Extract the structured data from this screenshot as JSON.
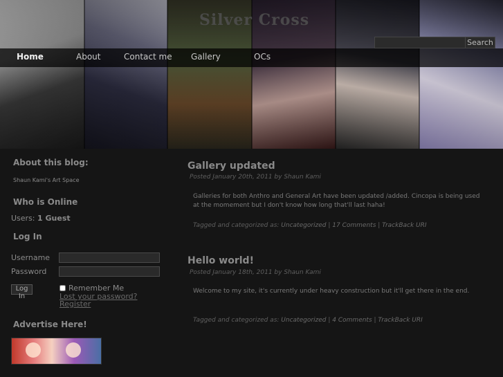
{
  "header": {
    "site_title": "Silver Cross",
    "search_placeholder": "",
    "search_button": "Search"
  },
  "nav": [
    {
      "label": "Home",
      "active": true
    },
    {
      "label": "About"
    },
    {
      "label": "Contact me"
    },
    {
      "label": "Gallery"
    },
    {
      "label": "OCs"
    }
  ],
  "sidebar": {
    "about_heading": "About this blog:",
    "about_text": "Shaun Kami's Art Space",
    "online_heading": "Who is Online",
    "online_prefix": "Users:",
    "online_count": "1 Guest",
    "login_heading": "Log In",
    "username_label": "Username",
    "password_label": "Password",
    "login_button": "Log In",
    "remember_label": "Remember Me",
    "lost_password": "Lost your password?",
    "register": "Register",
    "advertise_heading": "Advertise Here!"
  },
  "posts": [
    {
      "title": "Gallery updated",
      "meta": "Posted January 20th, 2011 by Shaun Kami",
      "body": "Galleries for both Anthro and General Art have been updated /added. Cincopa is being used at the momement but I don't know how long that'll last haha!",
      "footer_prefix": "Tagged and categorized as:",
      "category": "Uncategorized",
      "comments": "17 Comments",
      "trackback": "TrackBack URI"
    },
    {
      "title": "Hello world!",
      "meta": "Posted January 18th, 2011 by Shaun Kami",
      "body": "Welcome to my site, it's currently under heavy construction but it'll get there in the end.",
      "footer_prefix": "Tagged and categorized as:",
      "category": "Uncategorized",
      "comments": "4 Comments",
      "trackback": "TrackBack URI"
    }
  ]
}
